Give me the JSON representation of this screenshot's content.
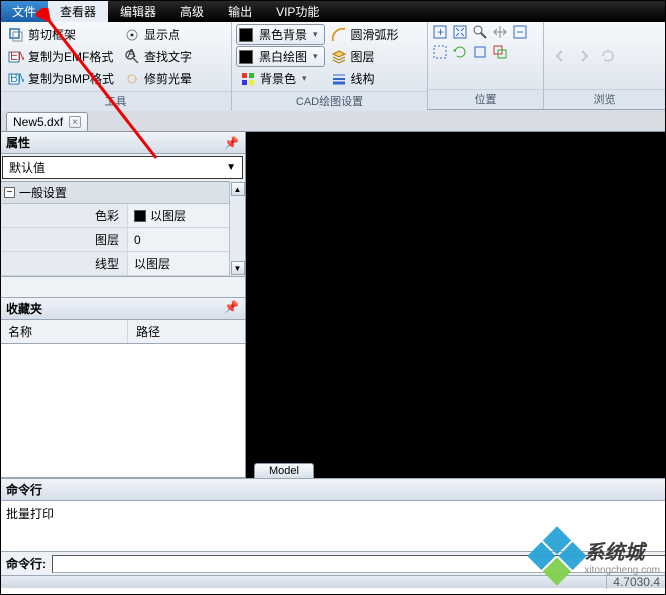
{
  "menu": {
    "file": "文件",
    "viewer": "查看器",
    "editor": "编辑器",
    "advanced": "高级",
    "output": "输出",
    "vip": "VIP功能"
  },
  "ribbon": {
    "group_tools": {
      "label": "工具",
      "cut_frame": "剪切框架",
      "copy_emf": "复制为EMF格式",
      "copy_bmp": "复制为BMP格式",
      "show_points": "显示点",
      "find_text": "查找文字",
      "trim_glow": "修剪光晕"
    },
    "group_cad": {
      "label": "CAD绘图设置",
      "black_bg": "黑色背景",
      "bw_draw": "黑白绘图",
      "bg_color": "背景色",
      "smooth_arc": "圆滑弧形",
      "layers": "图层",
      "lineweight": "线构"
    },
    "group_pos": {
      "label": "位置"
    },
    "group_browse": {
      "label": "浏览"
    }
  },
  "doc": {
    "name": "New5.dxf"
  },
  "propPanel": {
    "title": "属性",
    "combo": "默认值",
    "section": "一般设置",
    "rows": {
      "color_k": "色彩",
      "color_v": "以图层",
      "layer_k": "图层",
      "layer_v": "0",
      "ltype_k": "线型",
      "ltype_v": "以图层"
    }
  },
  "favPanel": {
    "title": "收藏夹",
    "col_name": "名称",
    "col_path": "路径"
  },
  "canvas": {
    "model_tab": "Model"
  },
  "cmd": {
    "title": "命令行",
    "output": "批量打印",
    "prompt": "命令行:"
  },
  "status": {
    "coords": "4.7030.4"
  },
  "watermark": {
    "brand": "系统城",
    "url": "xitongcheng.com"
  }
}
